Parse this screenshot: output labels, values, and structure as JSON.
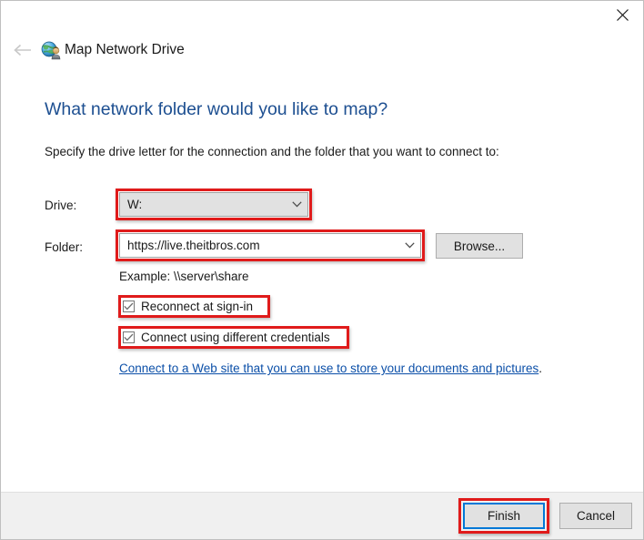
{
  "window": {
    "title": "Map Network Drive",
    "title_icon": "network-drive-globe-person-icon",
    "close_icon": "close-icon",
    "back_icon": "back-arrow-icon"
  },
  "content": {
    "heading": "What network folder would you like to map?",
    "subheading": "Specify the drive letter for the connection and the folder that you want to connect to:",
    "drive": {
      "label": "Drive:",
      "value": "W:",
      "dropdown_icon": "chevron-down-icon"
    },
    "folder": {
      "label": "Folder:",
      "value": "https://live.theitbros.com",
      "dropdown_icon": "chevron-down-icon",
      "browse_label": "Browse..."
    },
    "example_text": "Example: \\\\server\\share",
    "checkboxes": [
      {
        "label": "Reconnect at sign-in",
        "checked": true
      },
      {
        "label": "Connect using different credentials",
        "checked": true
      }
    ],
    "web_link": {
      "text": "Connect to a Web site that you can use to store your documents and pictures",
      "trailing": "."
    }
  },
  "footer": {
    "finish_label": "Finish",
    "cancel_label": "Cancel"
  },
  "colors": {
    "heading_blue": "#1d4f91",
    "link_blue": "#0b4fa8",
    "annotation_red": "#e01b1b",
    "focus_blue": "#0078d7",
    "footer_bg": "#f0f0f0",
    "button_bg": "#e1e1e1"
  }
}
